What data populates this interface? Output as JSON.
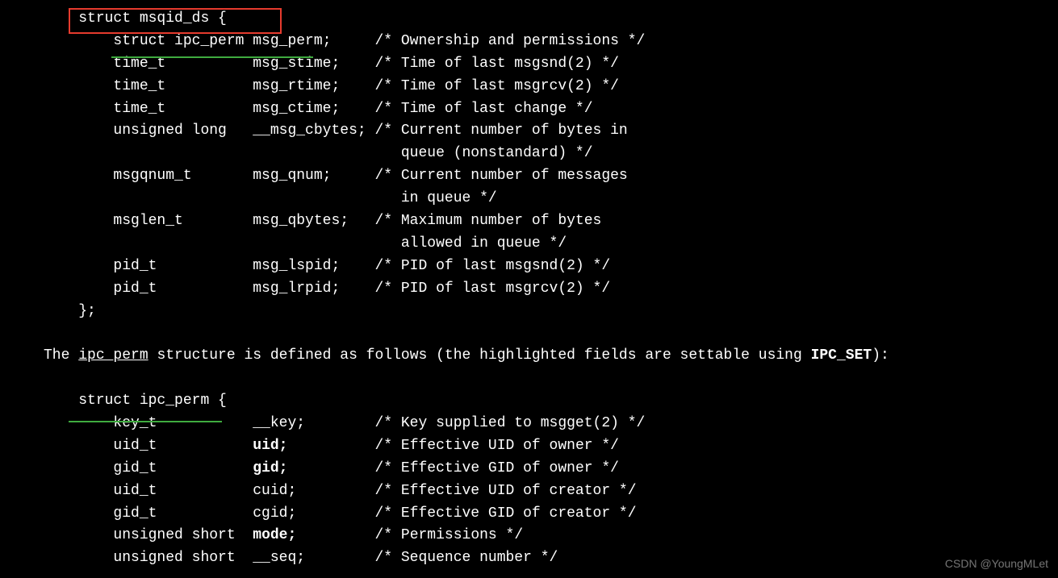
{
  "struct1": {
    "decl": "struct msqid_ds {",
    "lines": [
      {
        "type": "struct ipc_perm",
        "name": "msg_perm;",
        "comment": "/* Ownership and permissions */"
      },
      {
        "type": "time_t",
        "name": "msg_stime;",
        "comment": "/* Time of last msgsnd(2) */"
      },
      {
        "type": "time_t",
        "name": "msg_rtime;",
        "comment": "/* Time of last msgrcv(2) */"
      },
      {
        "type": "time_t",
        "name": "msg_ctime;",
        "comment": "/* Time of last change */"
      },
      {
        "type": "unsigned long",
        "name": "__msg_cbytes;",
        "comment": "/* Current number of bytes in"
      },
      {
        "cont": "queue (nonstandard) */"
      },
      {
        "type": "msgqnum_t",
        "name": "msg_qnum;",
        "comment": "/* Current number of messages"
      },
      {
        "cont": "in queue */"
      },
      {
        "type": "msglen_t",
        "name": "msg_qbytes;",
        "comment": "/* Maximum number of bytes"
      },
      {
        "cont": "allowed in queue */"
      },
      {
        "type": "pid_t",
        "name": "msg_lspid;",
        "comment": "/* PID of last msgsnd(2) */"
      },
      {
        "type": "pid_t",
        "name": "msg_lrpid;",
        "comment": "/* PID of last msgrcv(2) */"
      }
    ],
    "close": "};"
  },
  "middle": {
    "prefix": "The ",
    "ul": "ipc_perm",
    "mid": " structure is defined as follows (the highlighted fields are settable using ",
    "bold": "IPC_SET",
    "suffix": "):"
  },
  "struct2": {
    "decl": "struct ipc_perm {",
    "lines": [
      {
        "type": "key_t",
        "name": "__key;",
        "comment": "/* Key supplied to msgget(2) */"
      },
      {
        "type": "uid_t",
        "name": "uid;",
        "bold": true,
        "comment": "/* Effective UID of owner */"
      },
      {
        "type": "gid_t",
        "name": "gid;",
        "bold": true,
        "comment": "/* Effective GID of owner */"
      },
      {
        "type": "uid_t",
        "name": "cuid;",
        "comment": "/* Effective UID of creator */"
      },
      {
        "type": "gid_t",
        "name": "cgid;",
        "comment": "/* Effective GID of creator */"
      },
      {
        "type": "unsigned short",
        "name": "mode;",
        "bold": true,
        "comment": "/* Permissions */"
      },
      {
        "type": "unsigned short",
        "name": "__seq;",
        "comment": "/* Sequence number */"
      }
    ]
  },
  "watermark": "CSDN @YoungMLet"
}
